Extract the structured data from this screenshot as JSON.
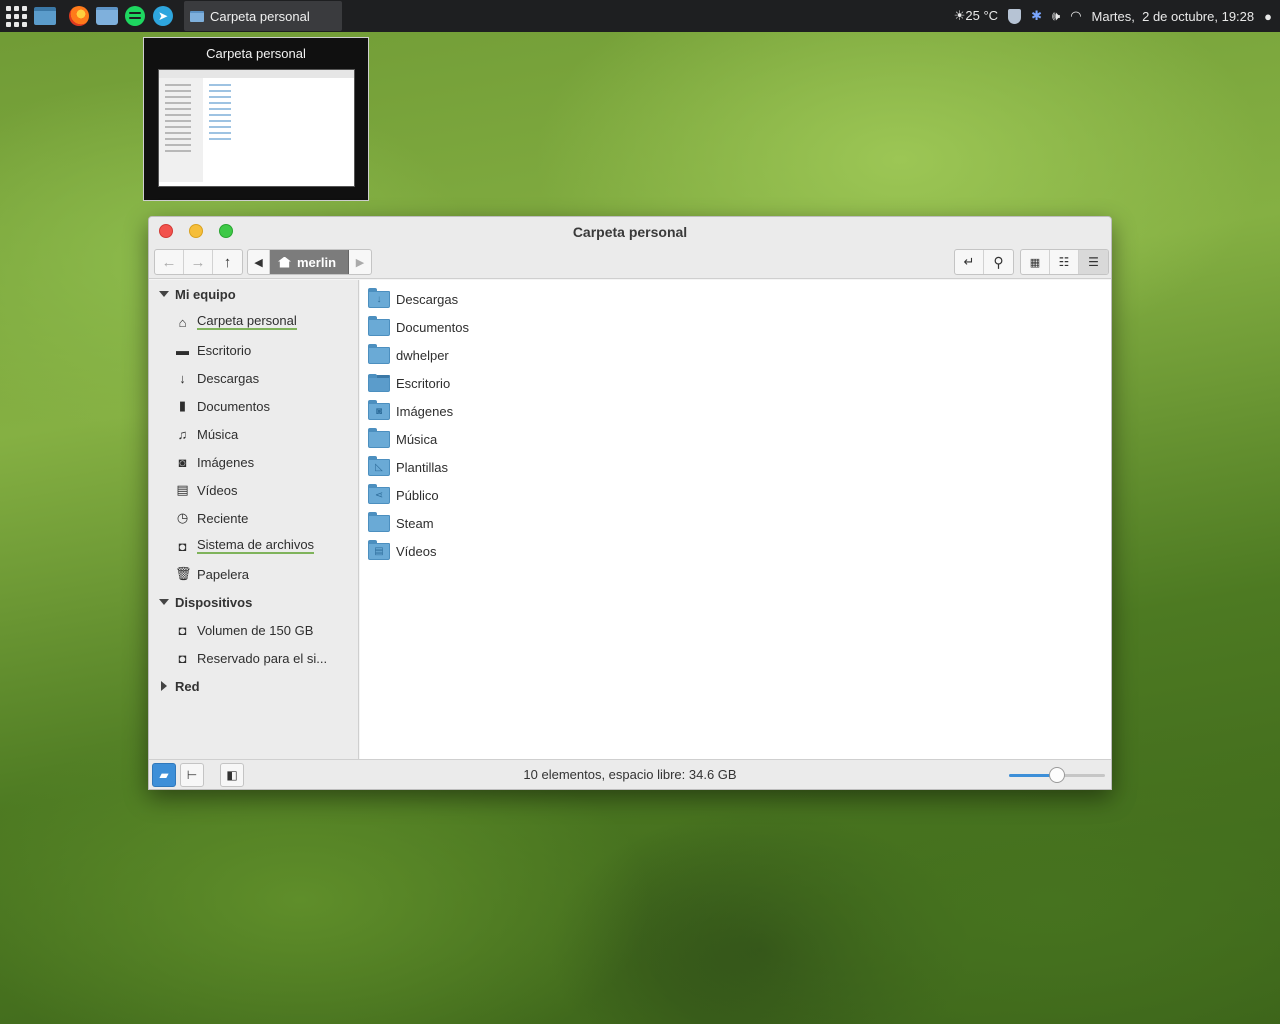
{
  "panel": {
    "task_title": "Carpeta personal",
    "weather": "25 °C",
    "clock": "Martes,  2 de octubre, 19:28"
  },
  "preview": {
    "title": "Carpeta personal"
  },
  "window": {
    "title": "Carpeta personal",
    "breadcrumb": "merlin"
  },
  "sidebar": {
    "sections": {
      "computer": "Mi equipo",
      "devices": "Dispositivos",
      "network": "Red"
    },
    "places": [
      {
        "label": "Carpeta personal",
        "icon": "home-icon"
      },
      {
        "label": "Escritorio",
        "icon": "desktop-icon"
      },
      {
        "label": "Descargas",
        "icon": "download-icon"
      },
      {
        "label": "Documentos",
        "icon": "document-icon"
      },
      {
        "label": "Música",
        "icon": "music-icon"
      },
      {
        "label": "Imágenes",
        "icon": "camera-icon"
      },
      {
        "label": "Vídeos",
        "icon": "film-icon"
      },
      {
        "label": "Reciente",
        "icon": "clock-icon"
      },
      {
        "label": "Sistema de archivos",
        "icon": "drive-icon"
      },
      {
        "label": "Papelera",
        "icon": "trash-icon"
      }
    ],
    "devices": [
      {
        "label": "Volumen de 150 GB",
        "icon": "drive-icon"
      },
      {
        "label": "Reservado para el si...",
        "icon": "drive-icon"
      }
    ]
  },
  "files": [
    {
      "name": "Descargas",
      "icon": "folder-download-icon"
    },
    {
      "name": "Documentos",
      "icon": "folder-icon"
    },
    {
      "name": "dwhelper",
      "icon": "folder-icon"
    },
    {
      "name": "Escritorio",
      "icon": "folder-desktop-icon"
    },
    {
      "name": "Imágenes",
      "icon": "folder-pictures-icon"
    },
    {
      "name": "Música",
      "icon": "folder-music-icon"
    },
    {
      "name": "Plantillas",
      "icon": "folder-templates-icon"
    },
    {
      "name": "Público",
      "icon": "folder-public-icon"
    },
    {
      "name": "Steam",
      "icon": "folder-icon"
    },
    {
      "name": "Vídeos",
      "icon": "folder-videos-icon"
    }
  ],
  "status": {
    "text": "10 elementos, espacio libre: 34.6 GB",
    "zoom_fraction": 0.5
  },
  "colors": {
    "accent": "#3d8fd8",
    "folder": "#6aaad6",
    "panel": "#1e1f21"
  }
}
